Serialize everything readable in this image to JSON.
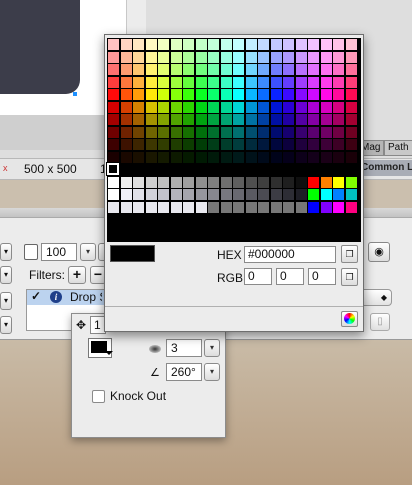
{
  "status": {
    "close_glyph": "x",
    "canvas_size": "500 x 500",
    "zoom_partial": "1"
  },
  "panel_tabs": {
    "mag": "Mag",
    "path": "Path",
    "common_library": "Common Li"
  },
  "properties": {
    "opacity_value": "100",
    "filters_label": "Filters:",
    "add_glyph": "+",
    "remove_glyph": "−",
    "filter_item_name": "Drop S",
    "info_glyph": "i",
    "check_glyph": "✓"
  },
  "drop_shadow": {
    "distance_value": "1",
    "blur_value": "3",
    "angle_value": "260°",
    "knockout_label": "Knock Out",
    "knockout_checked": false,
    "color": "#000000"
  },
  "color_picker": {
    "hex_label": "HEX",
    "hex_value": "#000000",
    "rgb_label": "RGB",
    "r": "0",
    "g": "0",
    "b": "0",
    "selected_color": "#000000"
  },
  "icons": {
    "move": "move-icon",
    "blur": "blur-icon",
    "angle": "angle-icon",
    "copy": "copy-icon",
    "color_wheel": "color-wheel-icon",
    "trash": "trash-icon"
  }
}
